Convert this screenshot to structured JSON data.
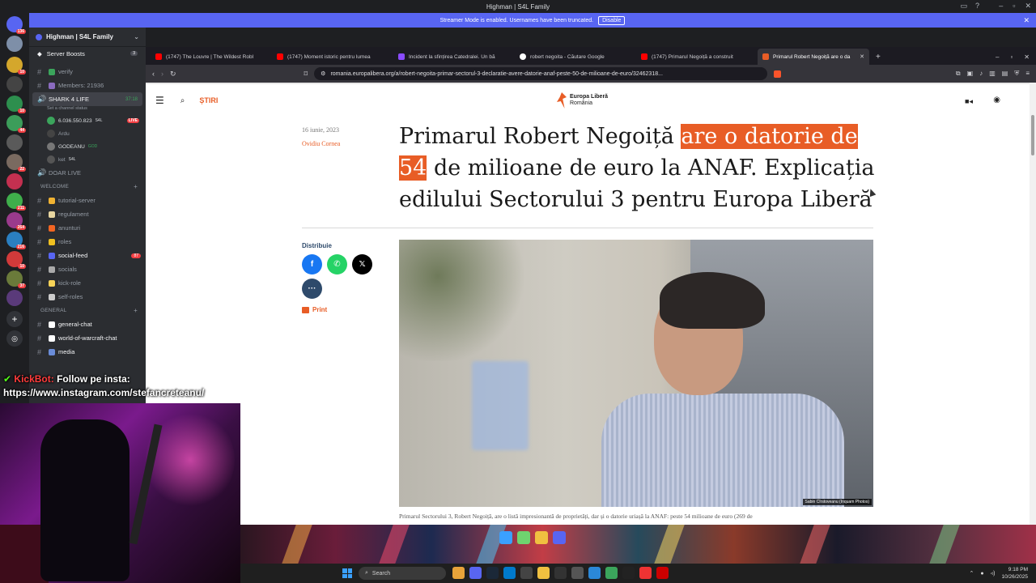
{
  "window_title": "Highman | S4L Family",
  "streamer_banner": {
    "text": "Streamer Mode is enabled. Usernames have been truncated.",
    "button": "Disable"
  },
  "server": {
    "name": "Highman | S4L Family",
    "boosts_label": "Server Boosts",
    "boosts_count": "3"
  },
  "guild_badges": [
    "136",
    "10",
    "10",
    "44",
    "22",
    "211",
    "264",
    "216",
    "10",
    "37"
  ],
  "channels_top": [
    {
      "label": "verify"
    },
    {
      "label": "Members: 21936"
    }
  ],
  "voice_channel": {
    "label": "SHARK 4 LIFE",
    "timer": "37:18",
    "status": "Set a channel status"
  },
  "voice_users": [
    {
      "name": "6.036.550.823",
      "tag": "S4L",
      "live": "LIVE"
    },
    {
      "name": "Ardu",
      "tag": "",
      "live": ""
    },
    {
      "name": "GODEANU",
      "tag": "GOD",
      "live": ""
    },
    {
      "name": "ket",
      "tag": "S4L",
      "live": ""
    }
  ],
  "doar_live": "DOAR LIVE",
  "category_welcome": "WELCOME",
  "welcome_channels": [
    {
      "label": "tutorial-server",
      "unread": ""
    },
    {
      "label": "regulament",
      "unread": ""
    },
    {
      "label": "anunturi",
      "unread": ""
    },
    {
      "label": "roles",
      "unread": ""
    },
    {
      "label": "social-feed",
      "unread": "87"
    },
    {
      "label": "socials",
      "unread": ""
    },
    {
      "label": "kick-role",
      "unread": ""
    },
    {
      "label": "self-roles",
      "unread": ""
    }
  ],
  "category_general": "GENERAL",
  "general_channels": [
    {
      "label": "general-chat"
    },
    {
      "label": "world-of-warcraft-chat"
    },
    {
      "label": "media"
    }
  ],
  "overlay": {
    "line1_bot": "KickBot:",
    "line1_msg": "Follow pe insta:",
    "line2": "https://www.instagram.com/stefancreteanu/"
  },
  "browser": {
    "tabs": [
      {
        "title": "(1747) The Louvre | The Wildest Robl",
        "color": "#ff0000"
      },
      {
        "title": "(1747) Moment istoric pentru lumea",
        "color": "#ff0000"
      },
      {
        "title": "Incident la sfințirea Catedralei. Un bă",
        "color": "#8a4bff"
      },
      {
        "title": "robert negoita - Căutare Google",
        "color": "#4285f4"
      },
      {
        "title": "(1747) Primarul Negoiță a construit",
        "color": "#ff0000"
      },
      {
        "title": "Primarul Robert Negoiță are o da",
        "color": "#e85d26"
      }
    ],
    "url": "romania.europalibera.org/a/robert-negoita-primar-sectorul-3-declaratie-avere-datorie-anaf-peste-50-de-milioane-de-euro/32462318..."
  },
  "site": {
    "section": "ȘTIRI",
    "logo_line1": "Europa Liberă",
    "logo_line2": "România"
  },
  "article": {
    "date": "16 iunie, 2023",
    "author": "Ovidiu Cornea",
    "headline_pre": "Primarul Robert Negoiță ",
    "headline_hl": "are o datorie de 54",
    "headline_post": " de milioane de euro la ANAF. Explicația edilului Sectorului 3 pentru Europa Liberă",
    "share_label": "Distribuie",
    "print_label": "Print",
    "photo_credit": "Sabin Cîrstoveanu (Inquam Photos)",
    "caption": "Primarul Sectorului 3, Robert Negoiță, are o listă impresionantă de proprietăți, dar și o datorie uriașă la ANAF: peste 54 milioane de euro (269 de"
  },
  "taskbar": {
    "search_placeholder": "Search",
    "time": "9:18 PM",
    "date": "10/26/2025"
  }
}
